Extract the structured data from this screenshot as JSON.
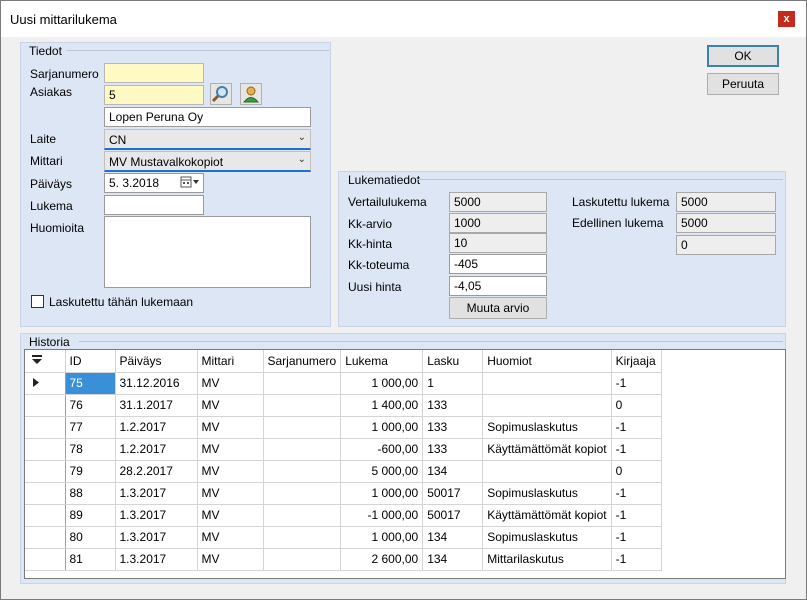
{
  "window": {
    "title": "Uusi mittarilukema",
    "close_glyph": "x"
  },
  "buttons": {
    "ok": "OK",
    "cancel": "Peruuta",
    "change_estimate": "Muuta arvio"
  },
  "tiedot": {
    "legend": "Tiedot",
    "serial_label": "Sarjanumero",
    "serial_value": "",
    "customer_label": "Asiakas",
    "customer_number": "5",
    "customer_name": "Lopen Peruna Oy",
    "device_label": "Laite",
    "device_value": "CN",
    "meter_label": "Mittari",
    "meter_value": "MV  Mustavalkokopiot",
    "date_label": "Päiväys",
    "date_value": "5.  3.2018",
    "reading_label": "Lukema",
    "reading_value": "",
    "notes_label": "Huomioita",
    "notes_value": "",
    "billed_checkbox_label": "Laskutettu tähän lukemaan",
    "billed_checked": false
  },
  "lukematiedot": {
    "legend": "Lukematiedot",
    "comparison_label": "Vertailulukema",
    "comparison_value": "5000",
    "kk_estimate_label": "Kk-arvio",
    "kk_estimate_value": "1000",
    "kk_price_label": "Kk-hinta",
    "kk_price_value": "10",
    "kk_actual_label": "Kk-toteuma",
    "kk_actual_value": "-405",
    "new_price_label": "Uusi hinta",
    "new_price_value": "-4,05",
    "billed_reading_label": "Laskutettu lukema",
    "billed_reading_value": "5000",
    "previous_reading_label": "Edellinen lukema",
    "previous_reading_value": "5000",
    "extra_value": "0"
  },
  "historia": {
    "legend": "Historia",
    "columns": [
      "ID",
      "Päiväys",
      "Mittari",
      "Sarjanumero",
      "Lukema",
      "Lasku",
      "Huomiot",
      "Kirjaaja"
    ],
    "rows": [
      {
        "id": "75",
        "date": "31.12.2016",
        "meter": "MV",
        "serial": "",
        "reading": "1 000,00",
        "invoice": "1",
        "note": "",
        "recorder": "-1"
      },
      {
        "id": "76",
        "date": "31.1.2017",
        "meter": "MV",
        "serial": "",
        "reading": "1 400,00",
        "invoice": "133",
        "note": "",
        "recorder": "0"
      },
      {
        "id": "77",
        "date": "1.2.2017",
        "meter": "MV",
        "serial": "",
        "reading": "1 000,00",
        "invoice": "133",
        "note": "Sopimuslaskutus",
        "recorder": "-1"
      },
      {
        "id": "78",
        "date": "1.2.2017",
        "meter": "MV",
        "serial": "",
        "reading": "-600,00",
        "invoice": "133",
        "note": "Käyttämättömät kopiot",
        "recorder": "-1"
      },
      {
        "id": "79",
        "date": "28.2.2017",
        "meter": "MV",
        "serial": "",
        "reading": "5 000,00",
        "invoice": "134",
        "note": "",
        "recorder": "0"
      },
      {
        "id": "88",
        "date": "1.3.2017",
        "meter": "MV",
        "serial": "",
        "reading": "1 000,00",
        "invoice": "50017",
        "note": "Sopimuslaskutus",
        "recorder": "-1"
      },
      {
        "id": "89",
        "date": "1.3.2017",
        "meter": "MV",
        "serial": "",
        "reading": "-1 000,00",
        "invoice": "50017",
        "note": "Käyttämättömät kopiot",
        "recorder": "-1"
      },
      {
        "id": "80",
        "date": "1.3.2017",
        "meter": "MV",
        "serial": "",
        "reading": "1 000,00",
        "invoice": "134",
        "note": "Sopimuslaskutus",
        "recorder": "-1"
      },
      {
        "id": "81",
        "date": "1.3.2017",
        "meter": "MV",
        "serial": "",
        "reading": "2 600,00",
        "invoice": "134",
        "note": "Mittarilaskutus",
        "recorder": "-1"
      }
    ]
  },
  "icons": {
    "search": "search-icon",
    "person": "person-icon",
    "calendar": "calendar-icon",
    "current_row": "row-pointer-icon",
    "filter": "filter-icon"
  },
  "colors": {
    "panel": "#dce6f4",
    "selection": "#3a8fd9",
    "required_field": "#fff9c4",
    "close": "#c42b1c"
  }
}
